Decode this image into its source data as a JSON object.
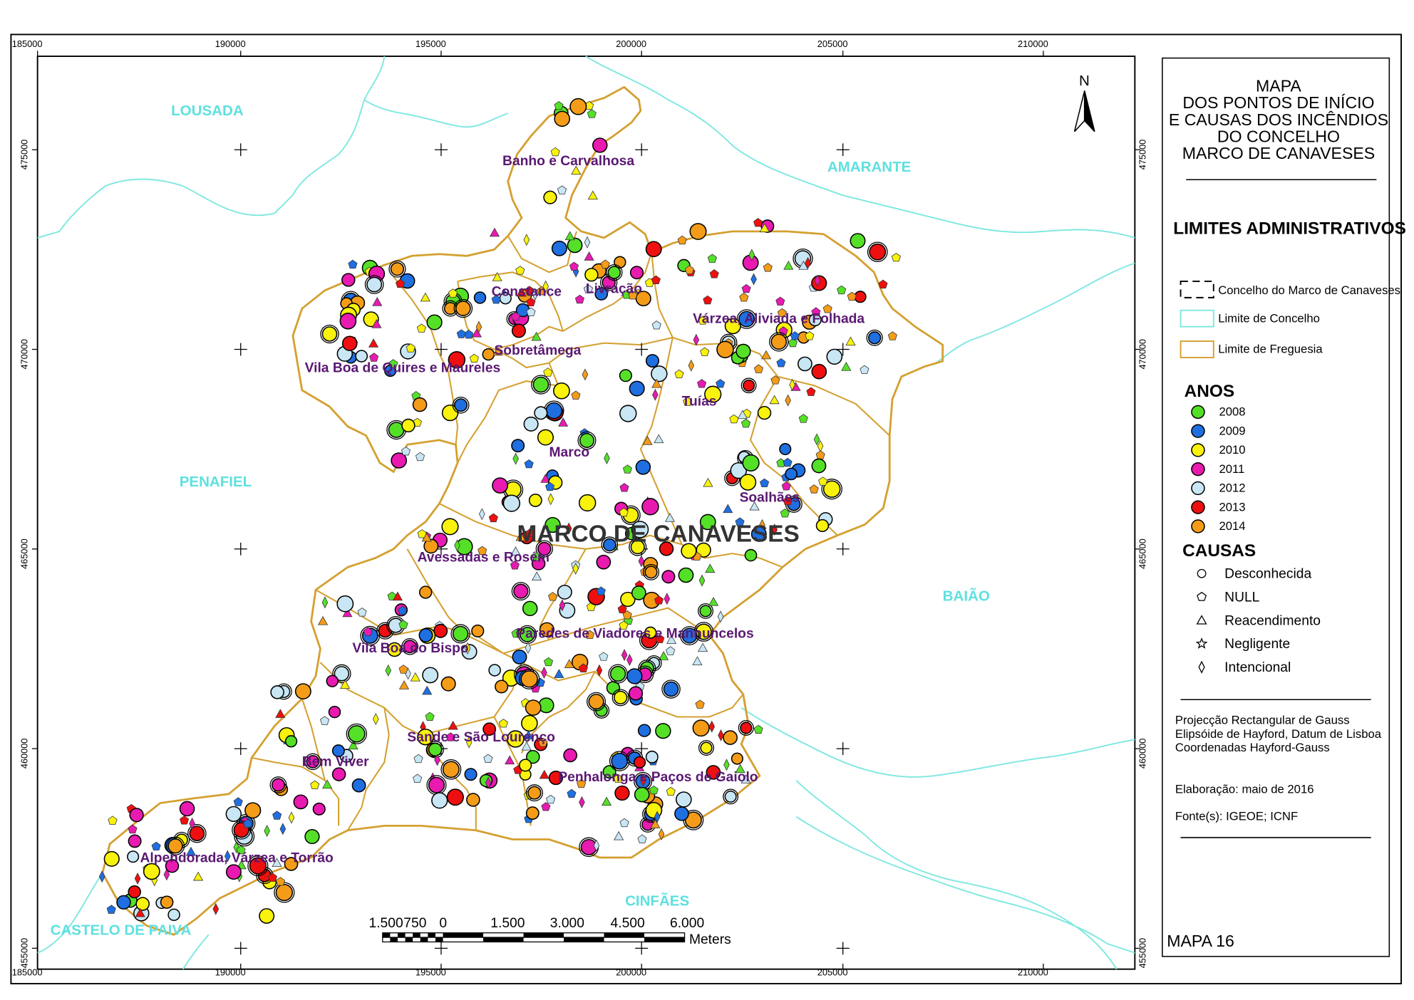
{
  "map": {
    "concelho_name": "MARCO DE CANAVESES",
    "concelhos": [
      "LOUSADA",
      "AMARANTE",
      "PENAFIEL",
      "BAIÃO",
      "CINFÃES",
      "CASTELO DE PAIVA"
    ],
    "freguesias": [
      "Banho e Carvalhosa",
      "Constance",
      "Livração",
      "Várzea, Aliviada e Folhada",
      "Sobretâmega",
      "Vila Boa de Quires e Maureles",
      "Tuías",
      "Marco",
      "Soalhães",
      "Avessadas e Rosém",
      "Paredes de Viadores e Manhuncelos",
      "Vila Boa do Bispo",
      "Sande e São Lourenço",
      "Bem Viver",
      "Penhalonga e Paços de Gaiolo",
      "Alpendorada, Várzea e Torrão"
    ],
    "x_ticks": [
      "185000",
      "190000",
      "195000",
      "200000",
      "205000",
      "210000"
    ],
    "y_ticks": [
      "475000",
      "470000",
      "465000",
      "460000",
      "455000"
    ],
    "north_label": "N",
    "map_number": "MAPA 16",
    "colors": {
      "concelho_boundary": "#7ee8e0",
      "freguesia_boundary": "#d4a030"
    }
  },
  "scale_bar": {
    "labels": [
      "1.500",
      "750",
      "0",
      "1.500",
      "3.000",
      "4.500",
      "6.000"
    ],
    "unit": "Meters"
  },
  "legend": {
    "title_lines": [
      "MAPA",
      "DOS PONTOS DE INÍCIO",
      "E CAUSAS DOS INCÊNDIOS",
      "DO CONCELHO",
      "MARCO DE CANAVESES"
    ],
    "admin_header": "LIMITES ADMINISTRATIVOS",
    "admin_items": [
      "Concelho do Marco de Canaveses",
      "Limite de Concelho",
      "Limite de Freguesia"
    ],
    "years_header": "ANOS",
    "years": [
      {
        "label": "2008",
        "color": "#55e028"
      },
      {
        "label": "2009",
        "color": "#1f6fe0"
      },
      {
        "label": "2010",
        "color": "#f8f20c"
      },
      {
        "label": "2011",
        "color": "#e81ab0"
      },
      {
        "label": "2012",
        "color": "#c8e6f4"
      },
      {
        "label": "2013",
        "color": "#ee1010"
      },
      {
        "label": "2014",
        "color": "#f49c18"
      }
    ],
    "causes_header": "CAUSAS",
    "causes": [
      {
        "label": "Desconhecida",
        "icon": "circle-icon"
      },
      {
        "label": "NULL",
        "icon": "pentagon-icon"
      },
      {
        "label": "Reacendimento",
        "icon": "triangle-icon"
      },
      {
        "label": "Negligente",
        "icon": "star-icon"
      },
      {
        "label": "Intencional",
        "icon": "diamond-icon"
      }
    ],
    "projection": [
      "Projecção Rectangular de Gauss",
      "Elipsóide de Hayford, Datum de Lisboa",
      "Coordenadas Hayford-Gauss"
    ],
    "elaboracao": "Elaboração: maio de 2016",
    "fontes": "Fonte(s): IGEOE; ICNF"
  }
}
